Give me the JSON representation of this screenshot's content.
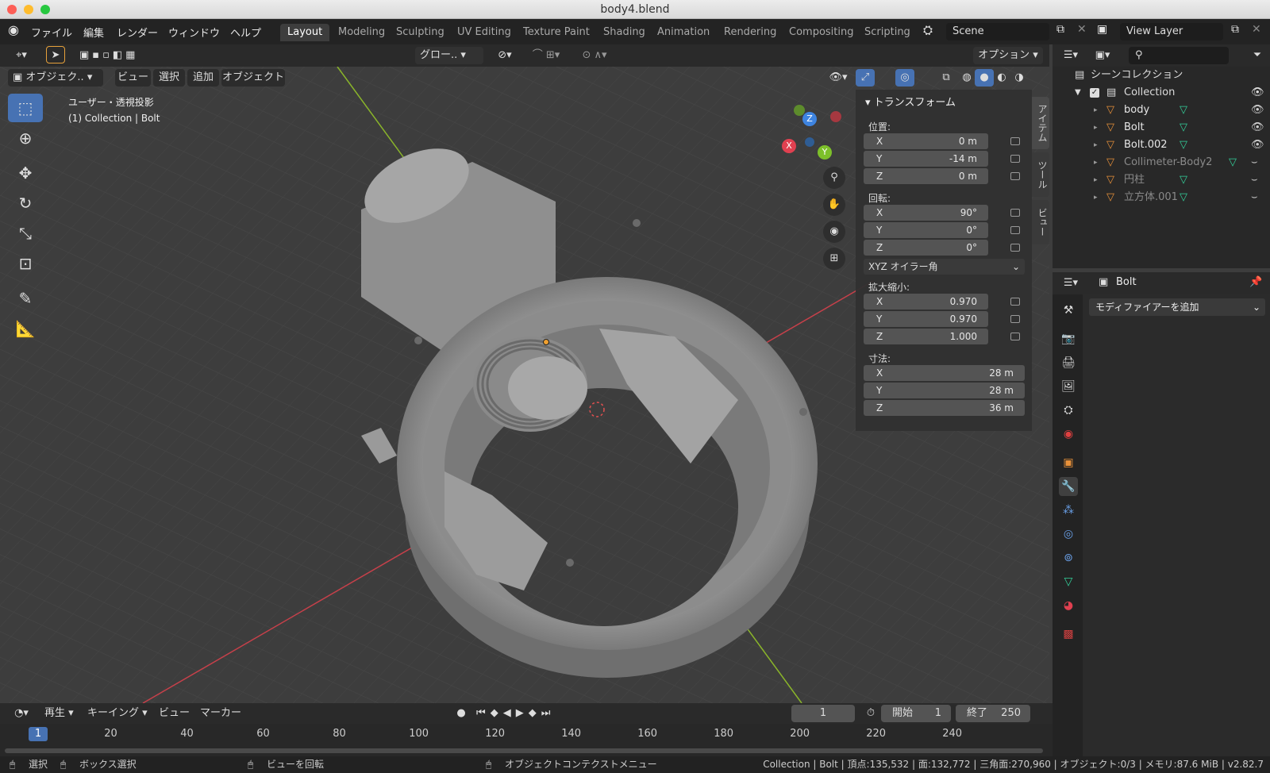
{
  "window_title": "body4.blend",
  "menus": [
    "ファイル",
    "編集",
    "レンダー",
    "ウィンドウ",
    "ヘルプ"
  ],
  "workspace_tabs": [
    "Layout",
    "Modeling",
    "Sculpting",
    "UV Editing",
    "Texture Paint",
    "Shading",
    "Animation",
    "Rendering",
    "Compositing",
    "Scripting"
  ],
  "active_tab": "Layout",
  "scene": "Scene",
  "view_layer": "View Layer",
  "viewport_header": {
    "mode": "オブジェク..",
    "menus": [
      "ビュー",
      "選択",
      "追加",
      "オブジェクト"
    ],
    "transform_orientation": "グロー..",
    "options": "オプション"
  },
  "viewport_overlay": {
    "view_name": "ユーザー・透視投影",
    "context": "(1) Collection | Bolt"
  },
  "gizmo": {
    "x": "X",
    "y": "Y",
    "z": "Z"
  },
  "npanel": {
    "header": "トランスフォーム",
    "location_label": "位置:",
    "location": [
      {
        "k": "X",
        "v": "0 m"
      },
      {
        "k": "Y",
        "v": "-14 m"
      },
      {
        "k": "Z",
        "v": "0 m"
      }
    ],
    "rotation_label": "回転:",
    "rotation": [
      {
        "k": "X",
        "v": "90°"
      },
      {
        "k": "Y",
        "v": "0°"
      },
      {
        "k": "Z",
        "v": "0°"
      }
    ],
    "rotation_mode": "XYZ オイラー角",
    "scale_label": "拡大縮小:",
    "scale": [
      {
        "k": "X",
        "v": "0.970"
      },
      {
        "k": "Y",
        "v": "0.970"
      },
      {
        "k": "Z",
        "v": "1.000"
      }
    ],
    "dimensions_label": "寸法:",
    "dimensions": [
      {
        "k": "X",
        "v": "28 m"
      },
      {
        "k": "Y",
        "v": "28 m"
      },
      {
        "k": "Z",
        "v": "36 m"
      }
    ],
    "side_tabs": [
      "アイテム",
      "ツール",
      "ビュー"
    ]
  },
  "outliner": {
    "root": "シーンコレクション",
    "collection": "Collection",
    "items": [
      {
        "name": "body",
        "dim": false
      },
      {
        "name": "Bolt",
        "dim": false
      },
      {
        "name": "Bolt.002",
        "dim": false
      },
      {
        "name": "Collimeter-Body2",
        "dim": true
      },
      {
        "name": "円柱",
        "dim": true
      },
      {
        "name": "立方体.001",
        "dim": true
      }
    ]
  },
  "properties": {
    "object_name": "Bolt",
    "add_modifier": "モディファイアーを追加"
  },
  "timeline": {
    "menus": [
      "再生",
      "キーイング",
      "ビュー",
      "マーカー"
    ],
    "current_frame": "1",
    "start_label": "開始",
    "start": "1",
    "end_label": "終了",
    "end": "250",
    "ruler": [
      "20",
      "40",
      "60",
      "80",
      "100",
      "120",
      "140",
      "160",
      "180",
      "200",
      "220",
      "240"
    ],
    "ruler_values": [
      20,
      40,
      60,
      80,
      100,
      120,
      140,
      160,
      180,
      200,
      220,
      240
    ],
    "playhead": "1"
  },
  "statusbar": {
    "select": "選択",
    "box_select": "ボックス選択",
    "rotate_view": "ビューを回転",
    "context_menu": "オブジェクトコンテクストメニュー",
    "stats": "Collection | Bolt | 頂点:135,532 | 面:132,772 | 三角面:270,960 | オブジェクト:0/3 | メモリ:87.6 MiB | v2.82.7"
  }
}
